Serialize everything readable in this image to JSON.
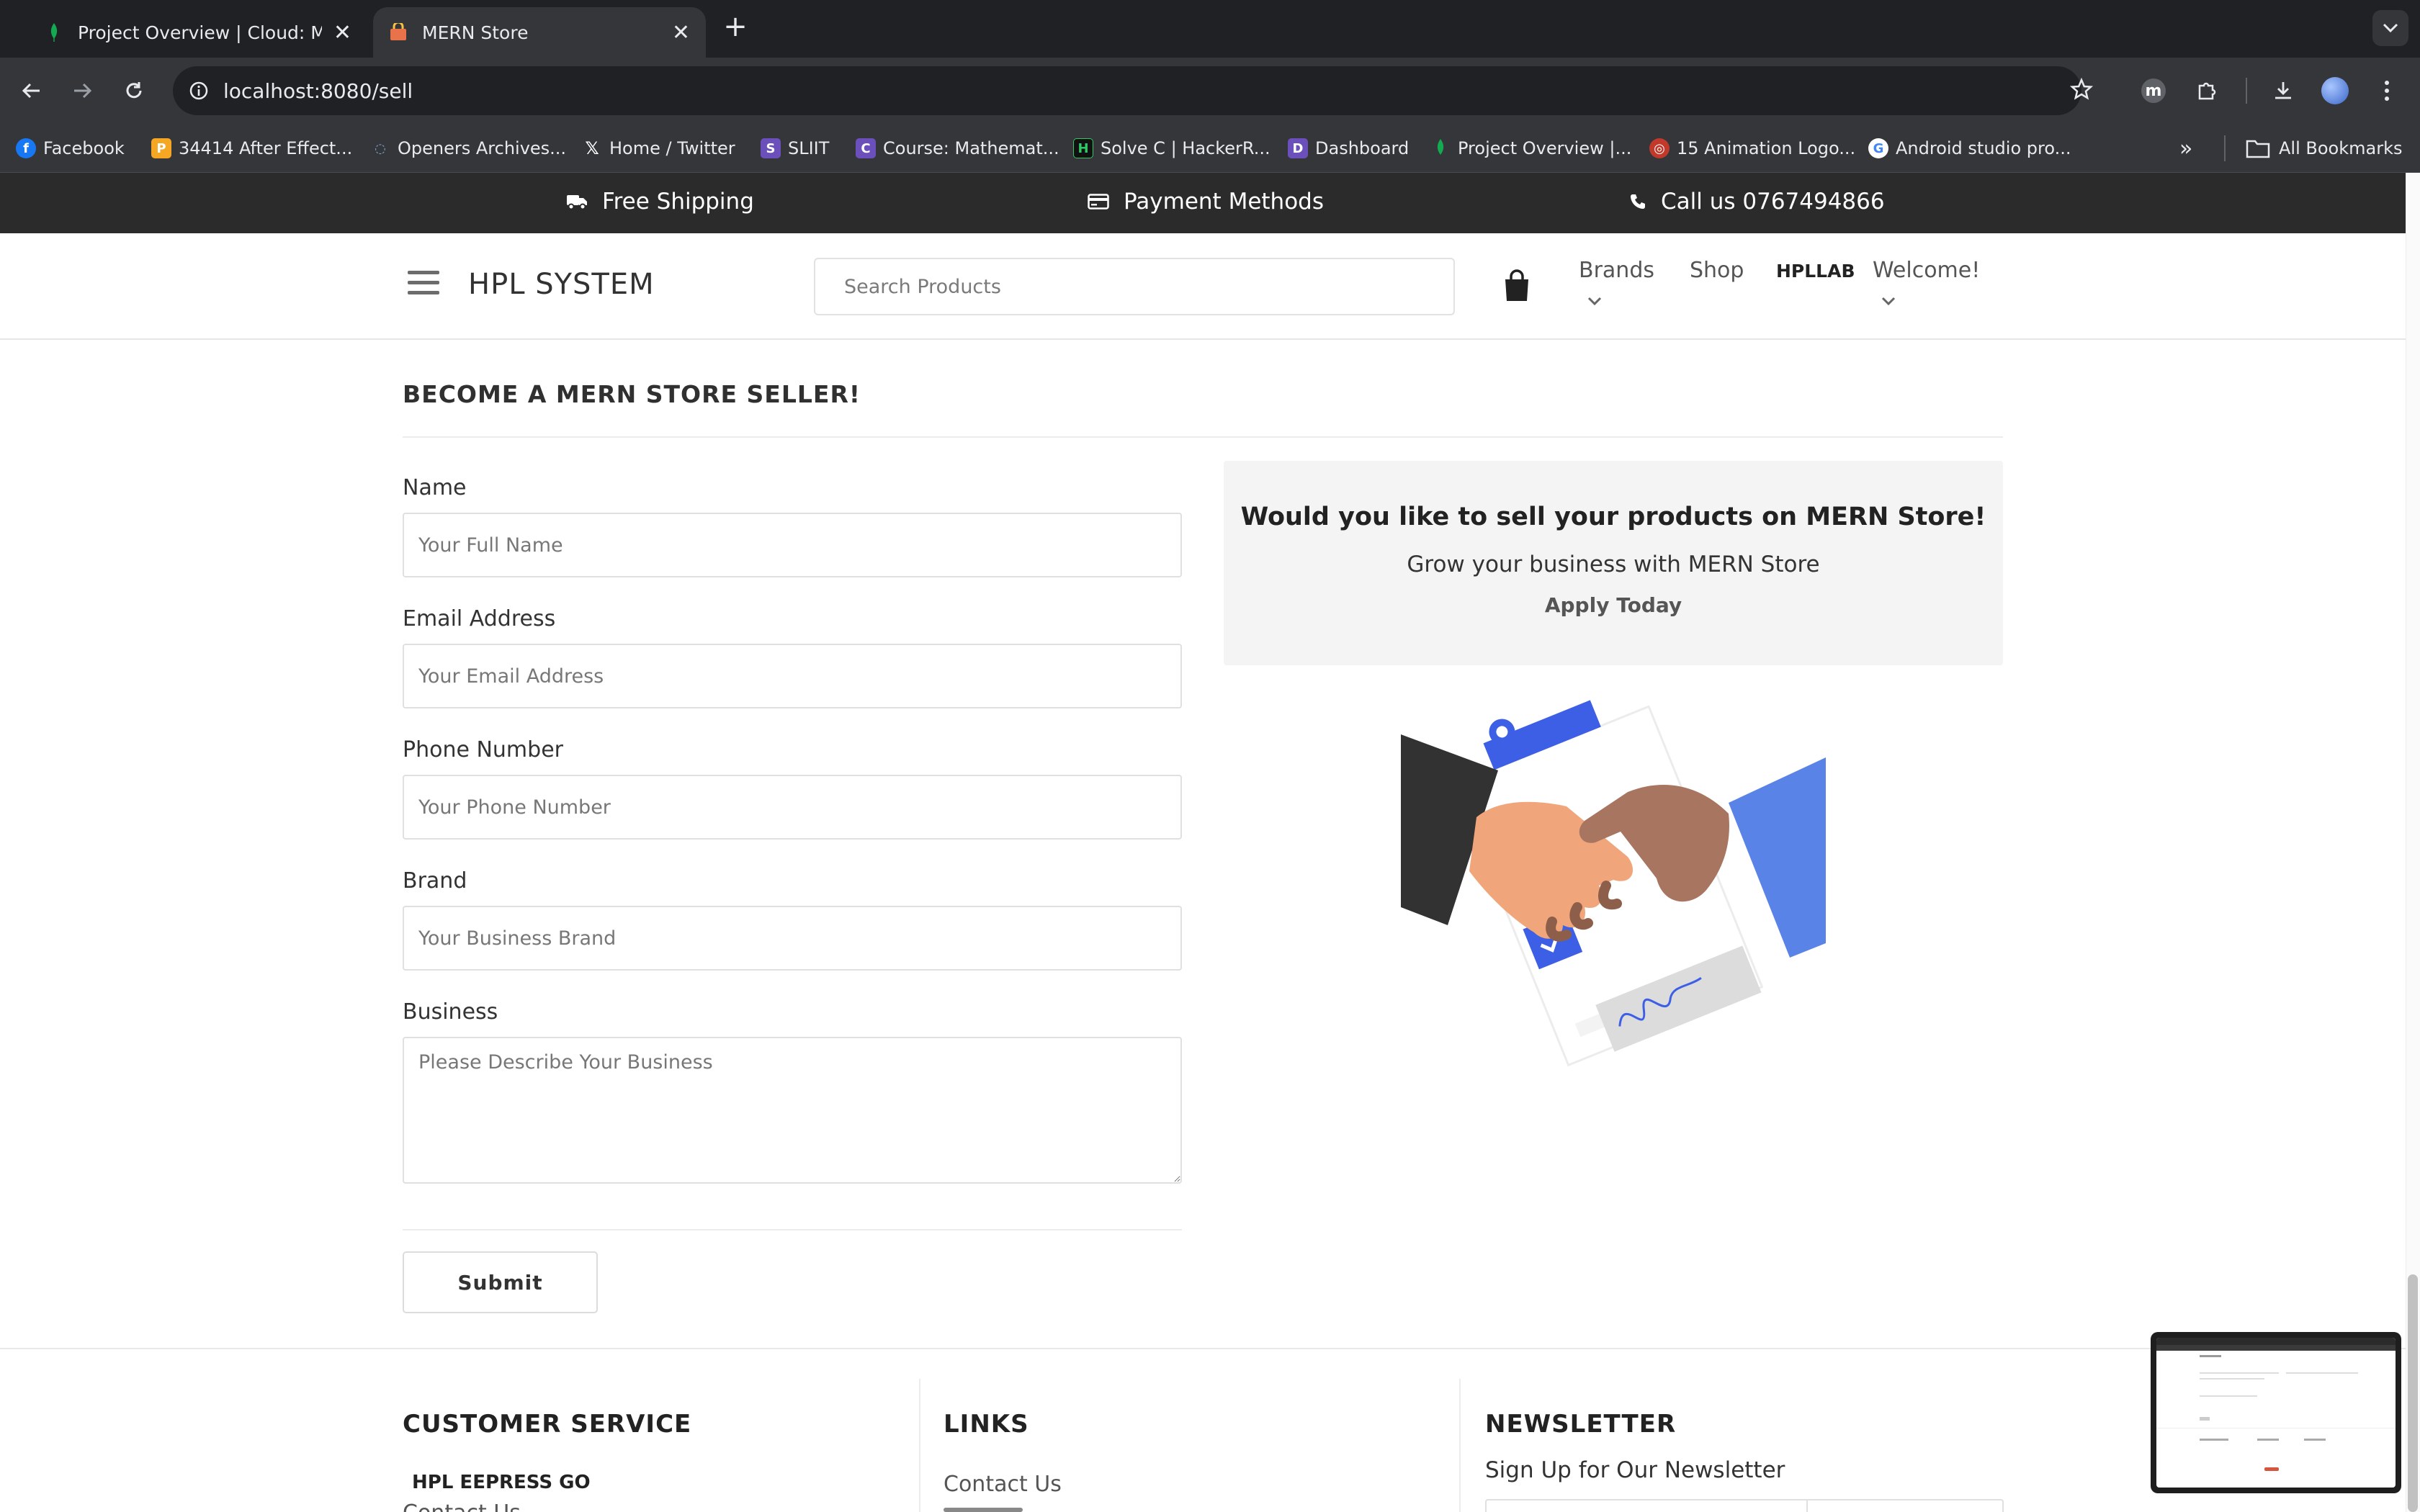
{
  "browser": {
    "tabs": [
      {
        "title": "Project Overview | Cloud: Mo",
        "active": false
      },
      {
        "title": "MERN Store",
        "active": true
      }
    ],
    "url": "localhost:8080/sell",
    "bookmarks": [
      {
        "label": "Facebook",
        "icon": "facebook-icon",
        "color": "#1877f2"
      },
      {
        "label": "34414 After Effect...",
        "icon": "p-icon",
        "color": "#f5a623"
      },
      {
        "label": "Openers Archives...",
        "icon": "openers-icon",
        "color": "#4a6fa5"
      },
      {
        "label": "Home / Twitter",
        "icon": "x-icon",
        "color": "#000000"
      },
      {
        "label": "SLIIT",
        "icon": "sliit-icon",
        "color": "#6b4fbb"
      },
      {
        "label": "Course: Mathemat...",
        "icon": "course-icon",
        "color": "#6b4fbb"
      },
      {
        "label": "Solve C | HackerR...",
        "icon": "hackerrank-icon",
        "color": "#111111"
      },
      {
        "label": "Dashboard",
        "icon": "dashboard-icon",
        "color": "#6b4fbb"
      },
      {
        "label": "Project Overview |...",
        "icon": "mongodb-icon",
        "color": "#13aa52"
      },
      {
        "label": "15 Animation Logo...",
        "icon": "animation-icon",
        "color": "#c0392b"
      },
      {
        "label": "Android studio pro...",
        "icon": "google-icon",
        "color": "#4285f4"
      }
    ],
    "all_bookmarks": "All Bookmarks",
    "profile_letter": "m"
  },
  "promo": {
    "shipping": "Free Shipping",
    "payment": "Payment Methods",
    "call": "Call us 0767494866"
  },
  "header": {
    "logo": "HPL SYSTEM",
    "search_placeholder": "Search Products",
    "nav": {
      "brands": "Brands",
      "shop": "Shop",
      "hpllab": "HPLLAB",
      "welcome": "Welcome!"
    }
  },
  "sell": {
    "title": "BECOME A MERN STORE SELLER!",
    "fields": {
      "name_label": "Name",
      "name_placeholder": "Your Full Name",
      "email_label": "Email Address",
      "email_placeholder": "Your Email Address",
      "phone_label": "Phone Number",
      "phone_placeholder": "Your Phone Number",
      "brand_label": "Brand",
      "brand_placeholder": "Your Business Brand",
      "business_label": "Business",
      "business_placeholder": "Please Describe Your Business"
    },
    "submit": "Submit",
    "info": {
      "headline": "Would you like to sell your products on MERN Store!",
      "sub": "Grow your business with MERN Store",
      "apply": "Apply Today"
    }
  },
  "footer": {
    "customer_service": "CUSTOMER SERVICE",
    "cs_item": "HPL EEPRESS GO",
    "cs_item2": "Contact Us",
    "links": "LINKS",
    "links_item": "Contact Us",
    "newsletter": "NEWSLETTER",
    "newsletter_sub": "Sign Up for Our Newsletter"
  },
  "colors": {
    "promo_bg": "#2b2b2b",
    "accent_blue": "#3d5fe6",
    "chrome_dark": "#202124"
  }
}
